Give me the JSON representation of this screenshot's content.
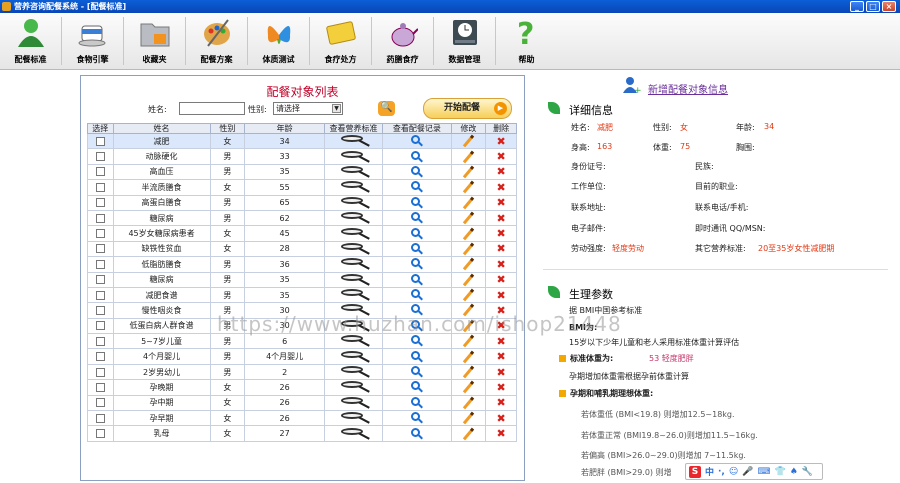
{
  "window": {
    "title": "营养咨询配餐系统 - [配餐标准]",
    "buttons": [
      "_",
      "□",
      "×"
    ]
  },
  "toolbar": [
    {
      "label": "配餐标准",
      "icon": "user-icon"
    },
    {
      "label": "食物引擎",
      "icon": "coffee-cup-icon"
    },
    {
      "label": "收藏夹",
      "icon": "folder-icon"
    },
    {
      "label": "配餐方案",
      "icon": "palette-icon"
    },
    {
      "label": "体质测试",
      "icon": "msn-butterfly-icon"
    },
    {
      "label": "食疗处方",
      "icon": "card-icon"
    },
    {
      "label": "药膳食疗",
      "icon": "teapot-icon"
    },
    {
      "label": "数据管理",
      "icon": "database-clock-icon"
    },
    {
      "label": "帮助",
      "icon": "question-icon"
    }
  ],
  "list": {
    "title": "配餐对象列表",
    "name_label": "姓名:",
    "gender_label": "性别:",
    "gender_value": "请选择",
    "start_button": "开始配餐",
    "columns": [
      "选择",
      "姓名",
      "性别",
      "年龄",
      "查看营养标准",
      "查看配餐记录",
      "修改",
      "删除"
    ],
    "rows": [
      [
        "减肥",
        "女",
        "34"
      ],
      [
        "动脉硬化",
        "男",
        "33"
      ],
      [
        "高血压",
        "男",
        "35"
      ],
      [
        "半流质膳食",
        "女",
        "55"
      ],
      [
        "高蛋白膳食",
        "男",
        "65"
      ],
      [
        "糖尿病",
        "男",
        "62"
      ],
      [
        "45岁女糖尿病患者",
        "女",
        "45"
      ],
      [
        "缺铁性贫血",
        "女",
        "28"
      ],
      [
        "低脂肪膳食",
        "男",
        "36"
      ],
      [
        "糖尿病",
        "男",
        "35"
      ],
      [
        "减肥食谱",
        "男",
        "35"
      ],
      [
        "慢性咽炎食",
        "男",
        "30"
      ],
      [
        "低蛋白病人群食谱",
        "男",
        "30"
      ],
      [
        "5~7岁儿童",
        "男",
        "6"
      ],
      [
        "4个月婴儿",
        "男",
        "4个月婴儿"
      ],
      [
        "2岁男幼儿",
        "男",
        "2"
      ],
      [
        "孕晚期",
        "女",
        "26"
      ],
      [
        "孕中期",
        "女",
        "26"
      ],
      [
        "孕早期",
        "女",
        "26"
      ],
      [
        "乳母",
        "女",
        "27"
      ]
    ]
  },
  "right": {
    "new_link": "新增配餐对象信息",
    "detail_title": "详细信息",
    "name_label": "姓名:",
    "name_value": "减肥",
    "gender_label": "性别:",
    "gender_value": "女",
    "age_label": "年龄:",
    "age_value": "34",
    "height_label": "身高:",
    "height_value": "163",
    "weight_label": "体重:",
    "weight_value": "75",
    "waist_label": "胸围:",
    "id_label": "身份证号:",
    "ethnic_label": "民族:",
    "work_label": "工作单位:",
    "job_label": "目前的职业:",
    "addr_label": "联系地址:",
    "phone_label": "联系电话/手机:",
    "email_label": "电子邮件:",
    "im_label": "即时通讯 QQ/MSN:",
    "labor_label": "劳动强度:",
    "labor_value": "轻度劳动",
    "other_label": "其它营养标准:",
    "other_value": "20至35岁女性减肥期",
    "param_title": "生理参数",
    "p1": "据 BMI中国参考标准",
    "p2": "BMI为:",
    "p3": "15岁以下少年儿童和老人采用标准体重计算评估",
    "std_weight_label": "标准体重为:",
    "std_weight_value": "53 轻度肥胖",
    "p4": "孕期增加体重需根据孕前体重计算",
    "p5": "孕期和哺乳期理想体重:",
    "l1": "若体重低  (BMI<19.8) 则增加12.5~18kg.",
    "l2": "若体重正常 (BMI19.8~26.0)则增加11.5~16kg.",
    "l3": "若偏高  (BMI>26.0~29.0)则增加 7~11.5kg.",
    "l4": "若肥胖  (BMI>29.0) 则增"
  },
  "watermark": "https://www.huzhan.com/ishop21448",
  "ime": [
    "中",
    "·,",
    "☺",
    "🎤",
    "⌨",
    "👕",
    "♠",
    "🔧"
  ]
}
